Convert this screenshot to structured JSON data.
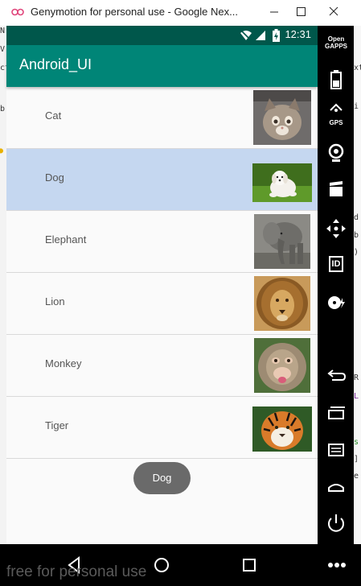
{
  "window": {
    "title": "Genymotion for personal use - Google Nex..."
  },
  "statusbar": {
    "time": "12:31"
  },
  "appbar": {
    "title": "Android_UI"
  },
  "list": {
    "items": [
      {
        "label": "Cat",
        "image": "cat-photo",
        "selected": false
      },
      {
        "label": "Dog",
        "image": "dog-photo",
        "selected": true
      },
      {
        "label": "Elephant",
        "image": "elephant-photo",
        "selected": false
      },
      {
        "label": "Lion",
        "image": "lion-photo",
        "selected": false
      },
      {
        "label": "Monkey",
        "image": "monkey-photo",
        "selected": false
      },
      {
        "label": "Tiger",
        "image": "tiger-photo",
        "selected": false
      }
    ]
  },
  "toast": {
    "text": "Dog"
  },
  "sidebar": {
    "open_gapps_label": "Open GAPPS",
    "gps_label": "GPS",
    "id_label": "ID"
  },
  "watermark": "free for personal use",
  "ide_fragments": {
    "left": [
      "N",
      "V",
      "ct"
    ],
    "right": [
      "i",
      "d",
      "b",
      ")",
      "R",
      "L",
      "s",
      "]",
      "e",
      "xt"
    ]
  },
  "colors": {
    "primary": "#008577",
    "primary_dark": "#00574b",
    "selected_row": "#c5d7f0",
    "toast": "#6a6a6a"
  }
}
